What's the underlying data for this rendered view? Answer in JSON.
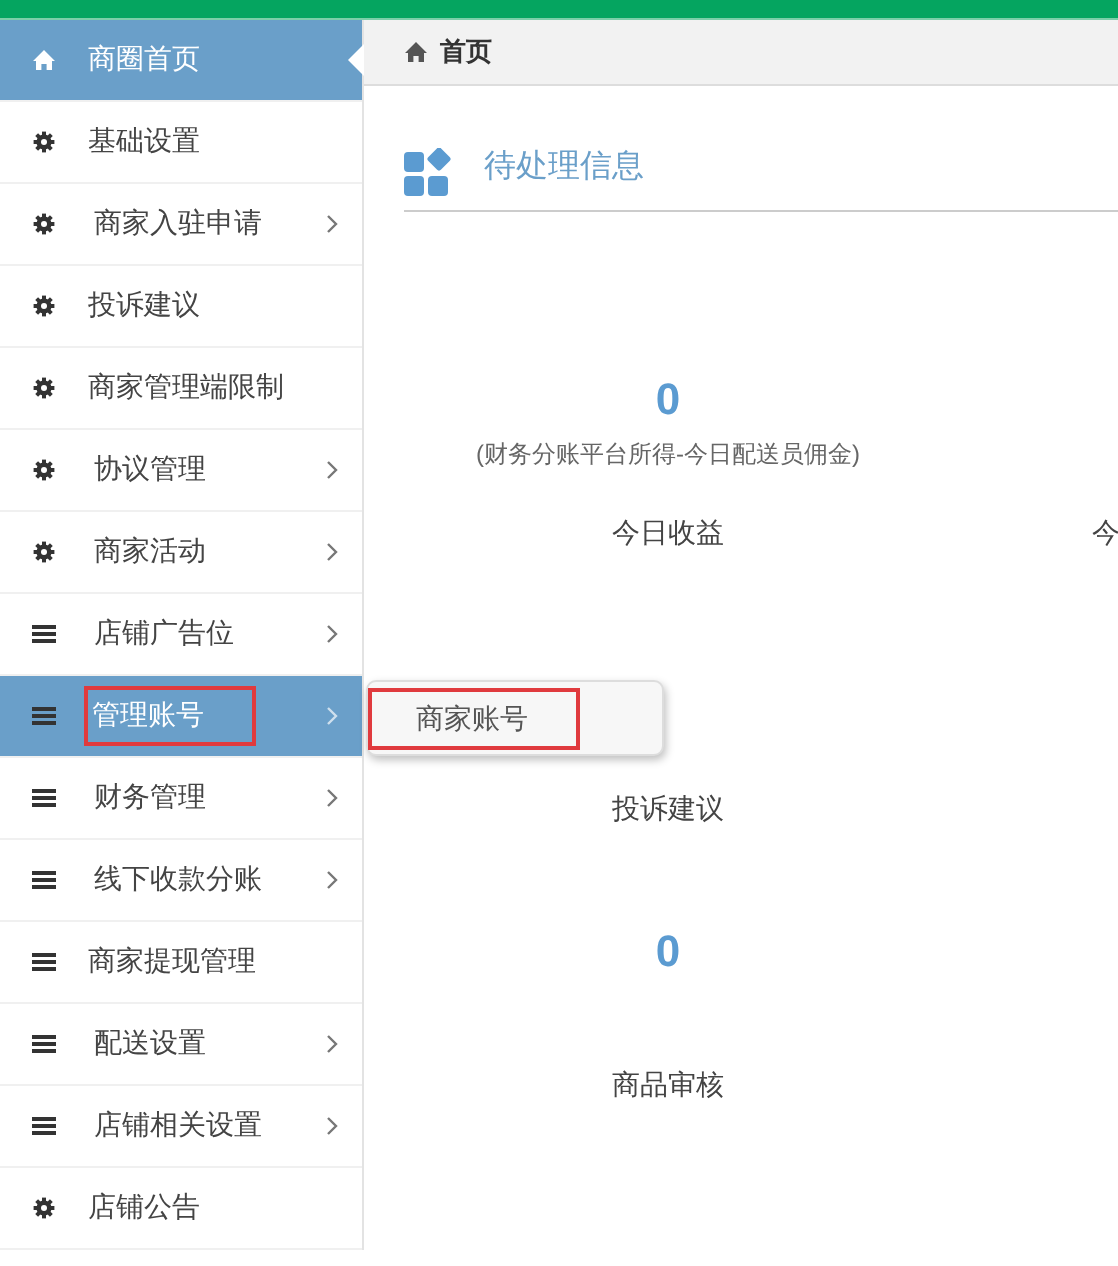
{
  "sidebar": {
    "items": [
      {
        "label": "商圈首页",
        "kind": "home",
        "has_submenu": false,
        "selected": true,
        "current": true,
        "annotated": false
      },
      {
        "label": "基础设置",
        "kind": "gear",
        "has_submenu": false,
        "selected": false,
        "current": false,
        "annotated": false
      },
      {
        "label": "商家入驻申请",
        "kind": "gear",
        "has_submenu": true,
        "selected": false,
        "current": false,
        "annotated": false
      },
      {
        "label": "投诉建议",
        "kind": "gear",
        "has_submenu": false,
        "selected": false,
        "current": false,
        "annotated": false
      },
      {
        "label": "商家管理端限制",
        "kind": "gear",
        "has_submenu": false,
        "selected": false,
        "current": false,
        "annotated": false
      },
      {
        "label": "协议管理",
        "kind": "gear",
        "has_submenu": true,
        "selected": false,
        "current": false,
        "annotated": false
      },
      {
        "label": "商家活动",
        "kind": "gear",
        "has_submenu": true,
        "selected": false,
        "current": false,
        "annotated": false
      },
      {
        "label": "店铺广告位",
        "kind": "list",
        "has_submenu": true,
        "selected": false,
        "current": false,
        "annotated": false
      },
      {
        "label": "管理账号",
        "kind": "list",
        "has_submenu": true,
        "selected": true,
        "current": false,
        "annotated": true
      },
      {
        "label": "财务管理",
        "kind": "list",
        "has_submenu": true,
        "selected": false,
        "current": false,
        "annotated": false
      },
      {
        "label": "线下收款分账",
        "kind": "list",
        "has_submenu": true,
        "selected": false,
        "current": false,
        "annotated": false
      },
      {
        "label": "商家提现管理",
        "kind": "list",
        "has_submenu": false,
        "selected": false,
        "current": false,
        "annotated": false
      },
      {
        "label": "配送设置",
        "kind": "list",
        "has_submenu": true,
        "selected": false,
        "current": false,
        "annotated": false
      },
      {
        "label": "店铺相关设置",
        "kind": "list",
        "has_submenu": true,
        "selected": false,
        "current": false,
        "annotated": false
      },
      {
        "label": "店铺公告",
        "kind": "gear",
        "has_submenu": false,
        "selected": false,
        "current": false,
        "annotated": false
      }
    ]
  },
  "submenu": {
    "items": [
      {
        "label": "商家账号",
        "annotated": true
      }
    ]
  },
  "breadcrumb": "首页",
  "section_title": "待处理信息",
  "stat_rows": [
    {
      "stats": [
        {
          "value": "0",
          "note": "(财务分账平台所得-今日配送员佣金)",
          "label": "今日收益"
        },
        {
          "label": "今"
        }
      ]
    },
    {
      "stats": [
        {
          "label": "投诉建议"
        }
      ]
    },
    {
      "stats": [
        {
          "value": "0",
          "label": "商品审核"
        }
      ]
    }
  ]
}
